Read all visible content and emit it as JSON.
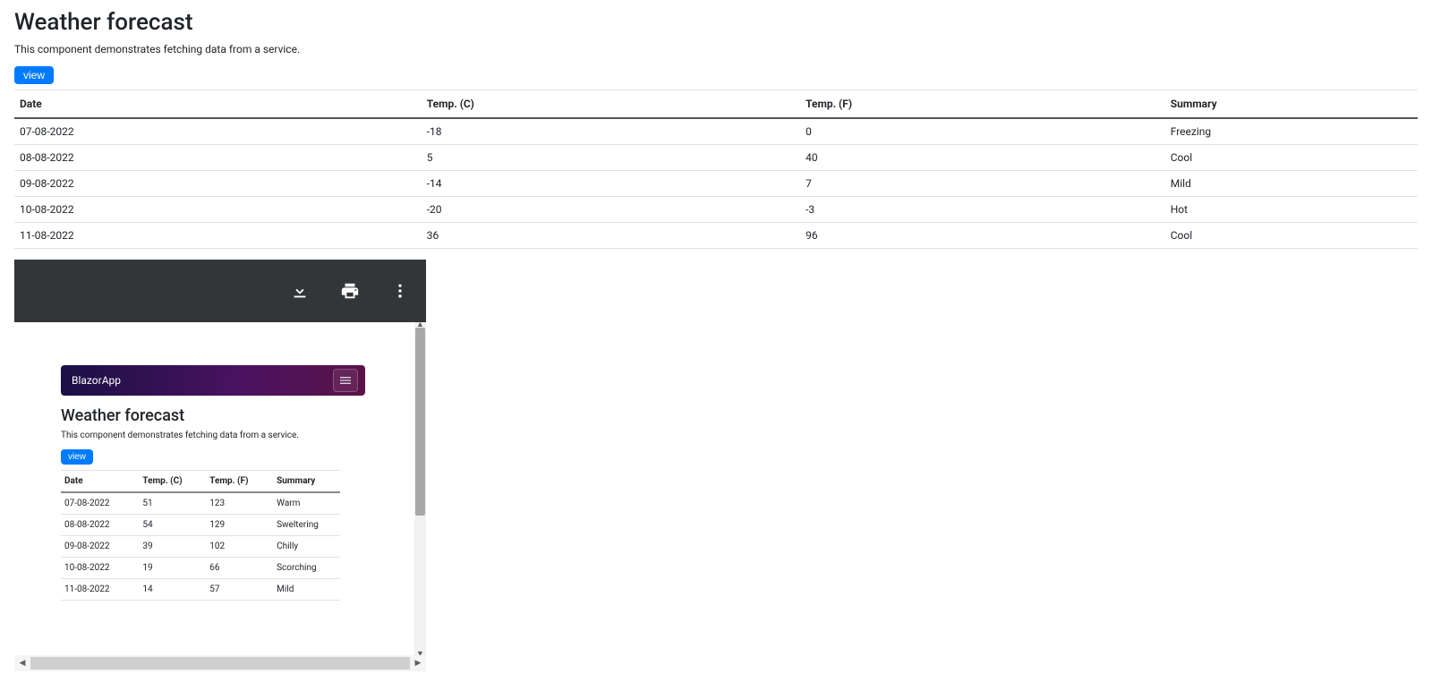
{
  "page": {
    "title": "Weather forecast",
    "description": "This component demonstrates fetching data from a service.",
    "view_button": "view"
  },
  "table": {
    "headers": {
      "date": "Date",
      "tempC": "Temp. (C)",
      "tempF": "Temp. (F)",
      "summary": "Summary"
    },
    "rows": [
      {
        "date": "07-08-2022",
        "tempC": "-18",
        "tempF": "0",
        "summary": "Freezing"
      },
      {
        "date": "08-08-2022",
        "tempC": "5",
        "tempF": "40",
        "summary": "Cool"
      },
      {
        "date": "09-08-2022",
        "tempC": "-14",
        "tempF": "7",
        "summary": "Mild"
      },
      {
        "date": "10-08-2022",
        "tempC": "-20",
        "tempF": "-3",
        "summary": "Hot"
      },
      {
        "date": "11-08-2022",
        "tempC": "36",
        "tempF": "96",
        "summary": "Cool"
      }
    ]
  },
  "pdf": {
    "app_brand": "BlazorApp",
    "title": "Weather forecast",
    "description": "This component demonstrates fetching data from a service.",
    "view_button": "view",
    "table": {
      "headers": {
        "date": "Date",
        "tempC": "Temp. (C)",
        "tempF": "Temp. (F)",
        "summary": "Summary"
      },
      "rows": [
        {
          "date": "07-08-2022",
          "tempC": "51",
          "tempF": "123",
          "summary": "Warm"
        },
        {
          "date": "08-08-2022",
          "tempC": "54",
          "tempF": "129",
          "summary": "Sweltering"
        },
        {
          "date": "09-08-2022",
          "tempC": "39",
          "tempF": "102",
          "summary": "Chilly"
        },
        {
          "date": "10-08-2022",
          "tempC": "19",
          "tempF": "66",
          "summary": "Scorching"
        },
        {
          "date": "11-08-2022",
          "tempC": "14",
          "tempF": "57",
          "summary": "Mild"
        }
      ]
    }
  }
}
